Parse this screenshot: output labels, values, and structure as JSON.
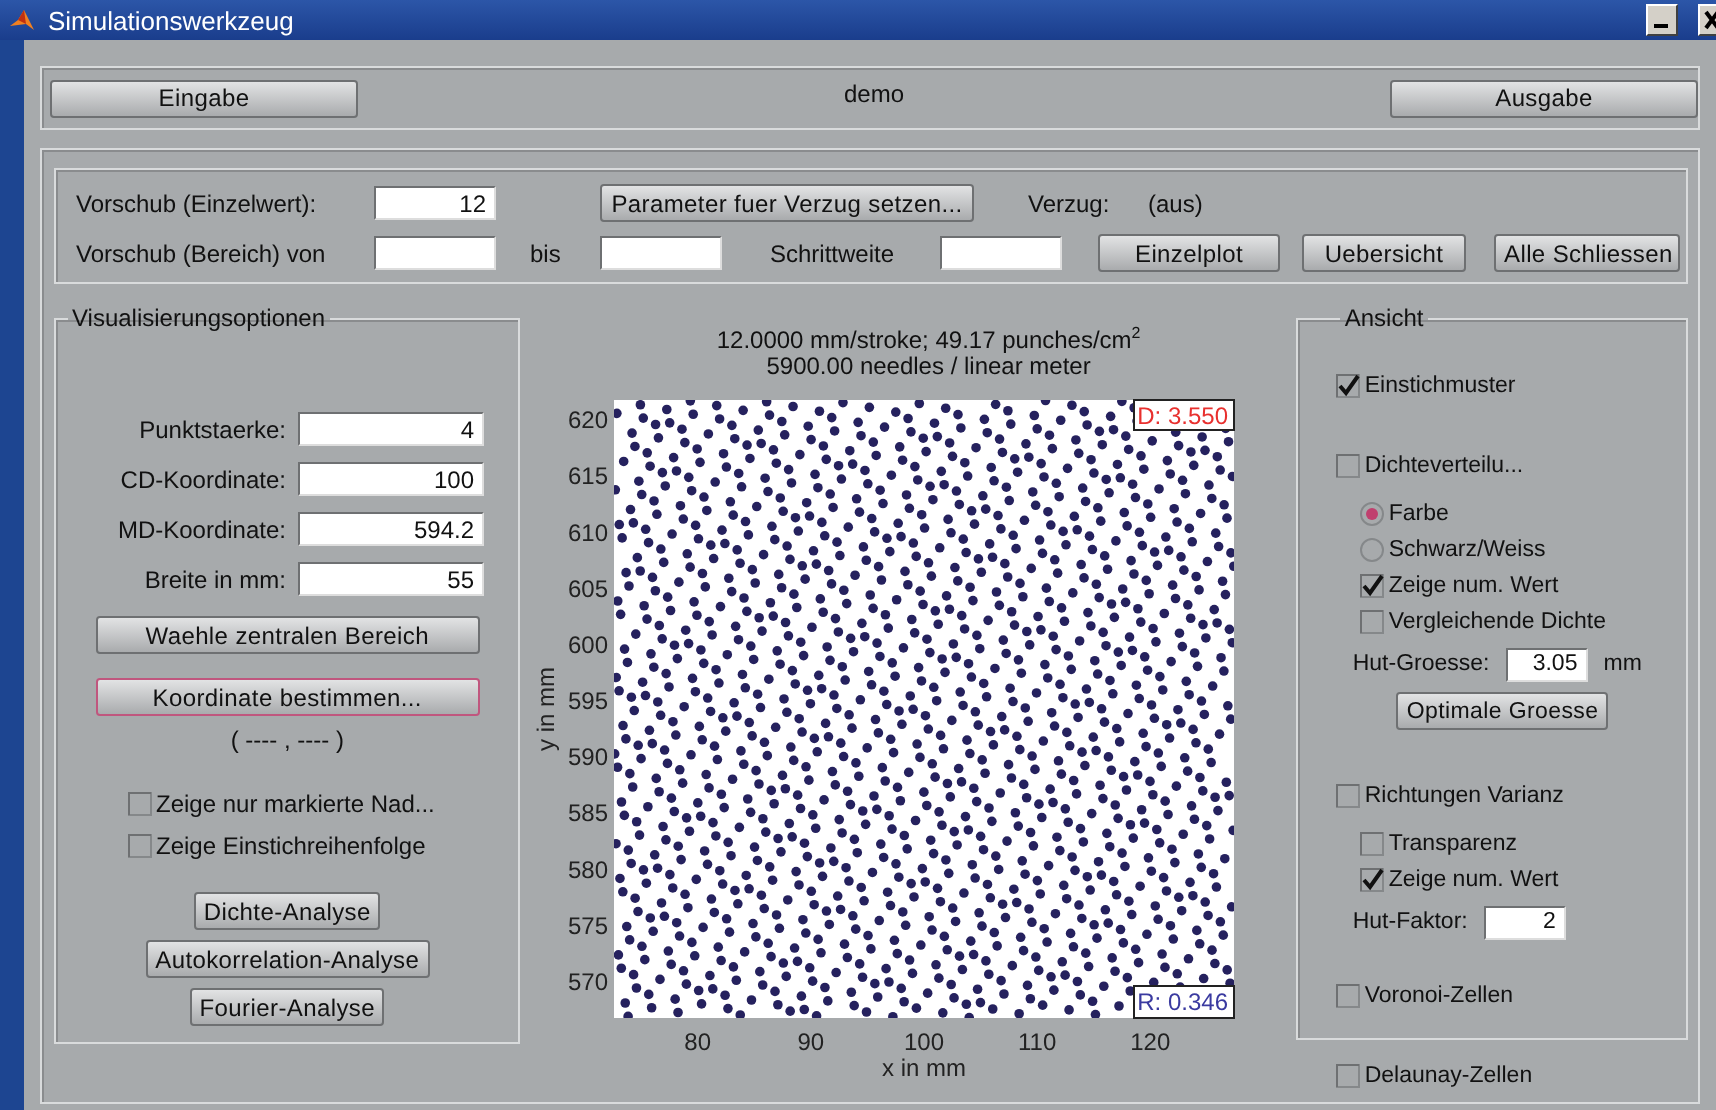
{
  "window": {
    "title": "Simulationswerkzeug"
  },
  "top_bar": {
    "left_button": "Eingabe",
    "project": "demo",
    "right_button": "Ausgabe"
  },
  "parameters": {
    "single_feed": {
      "label": "Vorschub (Einzelwert):",
      "value": "12"
    },
    "distortion_button": "Parameter fuer Verzug setzen...",
    "distortion_label": "Verzug:",
    "distortion_value": "(aus)",
    "range_feed": {
      "label": "Vorschub (Bereich) von",
      "to_label": "bis",
      "step_label": "Schrittweite"
    },
    "buttons": [
      "Einzelplot",
      "Uebersicht",
      "Alle Schliessen"
    ]
  },
  "visualization": {
    "title": "Visualisierungsoptionen",
    "fields": [
      {
        "label": "Punktstaerke:",
        "value": "4"
      },
      {
        "label": "CD-Koordinate:",
        "value": "100"
      },
      {
        "label": "MD-Koordinate:",
        "value": "594.2"
      },
      {
        "label": "Breite in mm:",
        "value": "55"
      }
    ],
    "buttons": [
      {
        "label": "Waehle zentralen Bereich",
        "focused": false
      },
      {
        "label": "Koordinate bestimmen...",
        "focused": true
      }
    ],
    "coordinate": "( ---- , ---- )",
    "checkboxes": [
      {
        "label": "Zeige nur markierte Nad...",
        "checked": false
      },
      {
        "label": "Zeige Einstichreihenfolge",
        "checked": false
      }
    ],
    "analysis_buttons": [
      "Dichte-Analyse",
      "Autokorrelation-Analyse",
      "Fourier-Analyse"
    ]
  },
  "plot": {
    "title_lines": [
      "12.0000 mm/stroke;  49.17 punches/cm$^{2}$",
      "5900.00 needles / linear meter"
    ],
    "xlabel": "x in mm",
    "ylabel": "y in mm",
    "xticks": [
      "80",
      "90",
      "100",
      "110",
      "120"
    ],
    "yticks": [
      "620",
      "615",
      "610",
      "605",
      "600",
      "595",
      "590",
      "585",
      "580",
      "575",
      "570"
    ],
    "density_label": "D: 3.550",
    "ratio_label": "R: 0.346"
  },
  "view": {
    "title": "Ansicht",
    "options": [
      {
        "kind": "checkbox",
        "label": "Einstichmuster",
        "checked": true
      },
      {
        "kind": "checkbox",
        "label": "Dichteverteilu...",
        "checked": false,
        "children": [
          {
            "kind": "radio",
            "label": "Farbe",
            "selected": true
          },
          {
            "kind": "radio",
            "label": "Schwarz/Weiss",
            "selected": false
          },
          {
            "kind": "checkbox",
            "label": "Zeige num. Wert",
            "checked": true
          },
          {
            "kind": "checkbox",
            "label": "Vergleichende Dichte",
            "checked": false
          },
          {
            "kind": "field",
            "label": "Hut-Groesse:",
            "value": "3.05",
            "unit": "mm"
          },
          {
            "kind": "button",
            "label": "Optimale Groesse"
          }
        ]
      },
      {
        "kind": "checkbox",
        "label": "Richtungen Varianz",
        "checked": false,
        "children": [
          {
            "kind": "checkbox",
            "label": "Transparenz",
            "checked": false
          },
          {
            "kind": "checkbox",
            "label": "Zeige num. Wert",
            "checked": true
          },
          {
            "kind": "field",
            "label": "Hut-Faktor:",
            "value": "2"
          }
        ]
      },
      {
        "kind": "checkbox",
        "label": "Voronoi-Zellen",
        "checked": false
      },
      {
        "kind": "checkbox",
        "label": "Delaunay-Zellen",
        "checked": false
      }
    ]
  }
}
